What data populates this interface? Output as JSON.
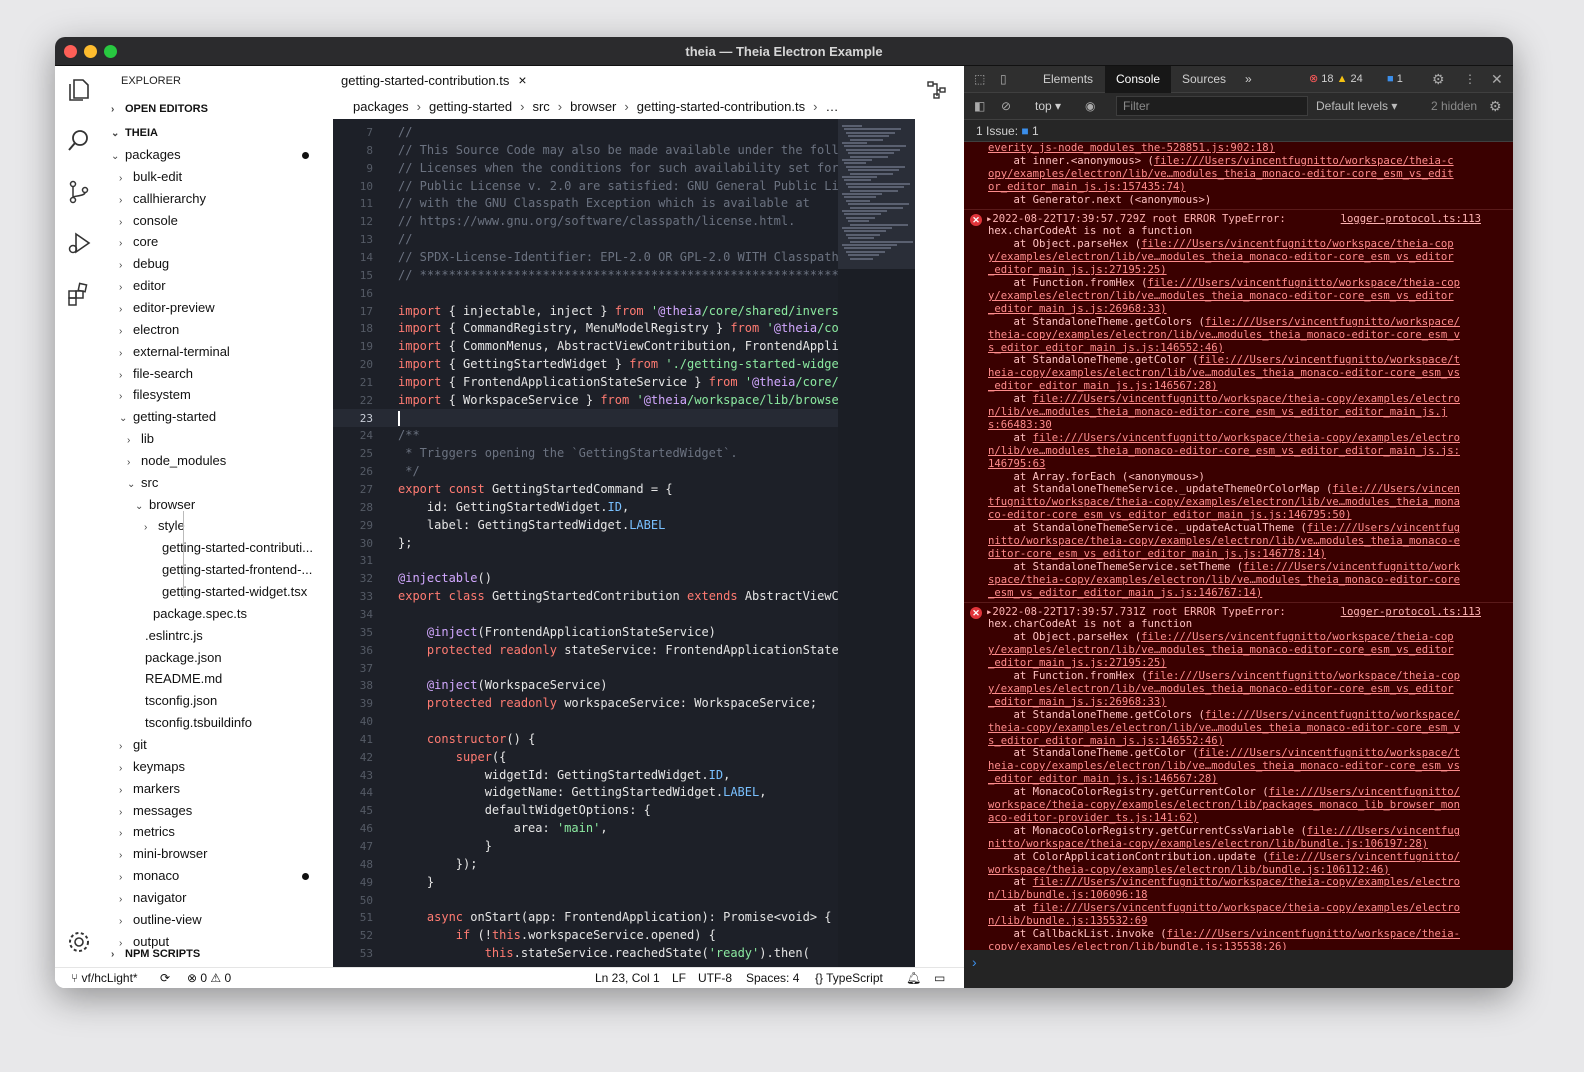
{
  "window": {
    "title": "theia — Theia Electron Example"
  },
  "explorer": {
    "title": "EXPLORER",
    "open_editors": "OPEN EDITORS",
    "root": "THEIA",
    "npm_scripts": "NPM SCRIPTS",
    "items": [
      {
        "label": "packages",
        "indent": 0,
        "open": true,
        "dot": true
      },
      {
        "label": "bulk-edit",
        "indent": 1,
        "open": false
      },
      {
        "label": "callhierarchy",
        "indent": 1,
        "open": false
      },
      {
        "label": "console",
        "indent": 1,
        "open": false
      },
      {
        "label": "core",
        "indent": 1,
        "open": false
      },
      {
        "label": "debug",
        "indent": 1,
        "open": false
      },
      {
        "label": "editor",
        "indent": 1,
        "open": false
      },
      {
        "label": "editor-preview",
        "indent": 1,
        "open": false
      },
      {
        "label": "electron",
        "indent": 1,
        "open": false
      },
      {
        "label": "external-terminal",
        "indent": 1,
        "open": false
      },
      {
        "label": "file-search",
        "indent": 1,
        "open": false
      },
      {
        "label": "filesystem",
        "indent": 1,
        "open": false
      },
      {
        "label": "getting-started",
        "indent": 1,
        "open": true
      },
      {
        "label": "lib",
        "indent": 2,
        "open": false
      },
      {
        "label": "node_modules",
        "indent": 2,
        "open": false
      },
      {
        "label": "src",
        "indent": 2,
        "open": true
      },
      {
        "label": "browser",
        "indent": 3,
        "open": true
      },
      {
        "label": "style",
        "indent": 4,
        "open": false
      },
      {
        "label": "getting-started-contributi...",
        "indent": 4,
        "file": true
      },
      {
        "label": "getting-started-frontend-...",
        "indent": 4,
        "file": true
      },
      {
        "label": "getting-started-widget.tsx",
        "indent": 4,
        "file": true
      },
      {
        "label": "package.spec.ts",
        "indent": 3,
        "file": true
      },
      {
        "label": ".eslintrc.js",
        "indent": 2,
        "file": true
      },
      {
        "label": "package.json",
        "indent": 2,
        "file": true
      },
      {
        "label": "README.md",
        "indent": 2,
        "file": true
      },
      {
        "label": "tsconfig.json",
        "indent": 2,
        "file": true
      },
      {
        "label": "tsconfig.tsbuildinfo",
        "indent": 2,
        "file": true
      },
      {
        "label": "git",
        "indent": 1,
        "open": false
      },
      {
        "label": "keymaps",
        "indent": 1,
        "open": false
      },
      {
        "label": "markers",
        "indent": 1,
        "open": false
      },
      {
        "label": "messages",
        "indent": 1,
        "open": false
      },
      {
        "label": "metrics",
        "indent": 1,
        "open": false
      },
      {
        "label": "mini-browser",
        "indent": 1,
        "open": false
      },
      {
        "label": "monaco",
        "indent": 1,
        "open": false,
        "dot": true
      },
      {
        "label": "navigator",
        "indent": 1,
        "open": false
      },
      {
        "label": "outline-view",
        "indent": 1,
        "open": false
      },
      {
        "label": "output",
        "indent": 1,
        "open": false
      }
    ]
  },
  "editor": {
    "tab": "getting-started-contribution.ts",
    "tab_close": "×",
    "breadcrumbs": [
      "packages",
      "getting-started",
      "src",
      "browser",
      "getting-started-contribution.ts",
      "…"
    ],
    "lines": [
      {
        "n": "7",
        "t": "//"
      },
      {
        "n": "8",
        "t": "// This Source Code may also be made available under the foll"
      },
      {
        "n": "9",
        "t": "// Licenses when the conditions for such availability set for"
      },
      {
        "n": "10",
        "t": "// Public License v. 2.0 are satisfied: GNU General Public Li"
      },
      {
        "n": "11",
        "t": "// with the GNU Classpath Exception which is available at"
      },
      {
        "n": "12",
        "t": "// https://www.gnu.org/software/classpath/license.html."
      },
      {
        "n": "13",
        "t": "//"
      },
      {
        "n": "14",
        "t": "// SPDX-License-Identifier: EPL-2.0 OR GPL-2.0 WITH Classpath"
      },
      {
        "n": "15",
        "t": "// *************************************************************"
      },
      {
        "n": "16",
        "t": ""
      },
      {
        "n": "17",
        "t": "import { injectable, inject } from '@theia/core/shared/invers"
      },
      {
        "n": "18",
        "t": "import { CommandRegistry, MenuModelRegistry } from '@theia/co"
      },
      {
        "n": "19",
        "t": "import { CommonMenus, AbstractViewContribution, FrontendAppli"
      },
      {
        "n": "20",
        "t": "import { GettingStartedWidget } from './getting-started-widge"
      },
      {
        "n": "21",
        "t": "import { FrontendApplicationStateService } from '@theia/core/"
      },
      {
        "n": "22",
        "t": "import { WorkspaceService } from '@theia/workspace/lib/browse"
      },
      {
        "n": "23",
        "t": ""
      },
      {
        "n": "24",
        "t": "/**"
      },
      {
        "n": "25",
        "t": " * Triggers opening the `GettingStartedWidget`."
      },
      {
        "n": "26",
        "t": " */"
      },
      {
        "n": "27",
        "t": "export const GettingStartedCommand = {"
      },
      {
        "n": "28",
        "t": "    id: GettingStartedWidget.ID,"
      },
      {
        "n": "29",
        "t": "    label: GettingStartedWidget.LABEL"
      },
      {
        "n": "30",
        "t": "};"
      },
      {
        "n": "31",
        "t": ""
      },
      {
        "n": "32",
        "t": "@injectable()"
      },
      {
        "n": "33",
        "t": "export class GettingStartedContribution extends AbstractViewCo"
      },
      {
        "n": "34",
        "t": ""
      },
      {
        "n": "35",
        "t": "    @inject(FrontendApplicationStateService)"
      },
      {
        "n": "36",
        "t": "    protected readonly stateService: FrontendApplicationState"
      },
      {
        "n": "37",
        "t": ""
      },
      {
        "n": "38",
        "t": "    @inject(WorkspaceService)"
      },
      {
        "n": "39",
        "t": "    protected readonly workspaceService: WorkspaceService;"
      },
      {
        "n": "40",
        "t": ""
      },
      {
        "n": "41",
        "t": "    constructor() {"
      },
      {
        "n": "42",
        "t": "        super({"
      },
      {
        "n": "43",
        "t": "            widgetId: GettingStartedWidget.ID,"
      },
      {
        "n": "44",
        "t": "            widgetName: GettingStartedWidget.LABEL,"
      },
      {
        "n": "45",
        "t": "            defaultWidgetOptions: {"
      },
      {
        "n": "46",
        "t": "                area: 'main',"
      },
      {
        "n": "47",
        "t": "            }"
      },
      {
        "n": "48",
        "t": "        });"
      },
      {
        "n": "49",
        "t": "    }"
      },
      {
        "n": "50",
        "t": ""
      },
      {
        "n": "51",
        "t": "    async onStart(app: FrontendApplication): Promise<void> {"
      },
      {
        "n": "52",
        "t": "        if (!this.workspaceService.opened) {"
      },
      {
        "n": "53",
        "t": "            this.stateService.reachedState('ready').then("
      }
    ],
    "current_line": "23"
  },
  "statusbar": {
    "branch": "vf/hcLight*",
    "problems_errors": "0",
    "problems_warnings": "0",
    "position": "Ln 23, Col 1",
    "eol": "LF",
    "encoding": "UTF-8",
    "spaces": "Spaces: 4",
    "language": "TypeScript"
  },
  "devtools": {
    "tabs": [
      "Elements",
      "Console",
      "Sources"
    ],
    "more": "»",
    "errors": "18",
    "warnings": "24",
    "messages": "1",
    "context": "top ▾",
    "filter_placeholder": "Filter",
    "levels": "Default levels ▾",
    "hidden": "2 hidden",
    "issues_label": "1 Issue:",
    "issues_count": "1",
    "prompt": "›",
    "entries": [
      {
        "type": "cont",
        "lines": [
          {
            "k": "l",
            "t": "everity_js-node_modules_the-528851.js:902:18)"
          },
          {
            "k": "m",
            "pre": "    at inner.<anonymous> (",
            "t": "file:///Users/vincentfugnitto/workspace/theia-c"
          },
          {
            "k": "l",
            "t": "opy/examples/electron/lib/ve…modules_theia_monaco-editor-core_esm_vs_edit"
          },
          {
            "k": "lm",
            "t": "or_editor_main_js.js:157435:74)"
          },
          {
            "k": "x",
            "t": "    at Generator.next (<anonymous>)"
          }
        ]
      },
      {
        "type": "err",
        "head": "▸2022-08-22T17:39:57.729Z root ERROR TypeError:",
        "src": "logger-protocol.ts:113",
        "lines": [
          {
            "k": "x",
            "t": "hex.charCodeAt is not a function"
          },
          {
            "k": "m",
            "pre": "    at Object.parseHex (",
            "t": "file:///Users/vincentfugnitto/workspace/theia-cop"
          },
          {
            "k": "l",
            "t": "y/examples/electron/lib/ve…modules_theia_monaco-editor-core_esm_vs_editor"
          },
          {
            "k": "lm",
            "t": "_editor_main_js.js:27195:25)"
          },
          {
            "k": "m",
            "pre": "    at Function.fromHex (",
            "t": "file:///Users/vincentfugnitto/workspace/theia-cop"
          },
          {
            "k": "l",
            "t": "y/examples/electron/lib/ve…modules_theia_monaco-editor-core_esm_vs_editor"
          },
          {
            "k": "lm",
            "t": "_editor_main_js.js:26968:33)"
          },
          {
            "k": "m",
            "pre": "    at StandaloneTheme.getColors (",
            "t": "file:///Users/vincentfugnitto/workspace/"
          },
          {
            "k": "l",
            "t": "theia-copy/examples/electron/lib/ve…modules_theia_monaco-editor-core_esm_v"
          },
          {
            "k": "lm",
            "t": "s_editor_editor_main_js.js:146552:46)"
          },
          {
            "k": "m",
            "pre": "    at StandaloneTheme.getColor (",
            "t": "file:///Users/vincentfugnitto/workspace/t"
          },
          {
            "k": "l",
            "t": "heia-copy/examples/electron/lib/ve…modules_theia_monaco-editor-core_esm_vs"
          },
          {
            "k": "lm",
            "t": "_editor_editor_main_js.js:146567:28)"
          },
          {
            "k": "m",
            "pre": "    at ",
            "t": "file:///Users/vincentfugnitto/workspace/theia-copy/examples/electro"
          },
          {
            "k": "l",
            "t": "n/lib/ve…modules_theia_monaco-editor-core_esm_vs_editor_editor_main_js.j"
          },
          {
            "k": "lm",
            "t": "s:66483:30"
          },
          {
            "k": "m",
            "pre": "    at ",
            "t": "file:///Users/vincentfugnitto/workspace/theia-copy/examples/electro"
          },
          {
            "k": "l",
            "t": "n/lib/ve…modules_theia_monaco-editor-core_esm_vs_editor_editor_main_js.js:"
          },
          {
            "k": "lm",
            "t": "146795:63"
          },
          {
            "k": "x",
            "t": "    at Array.forEach (<anonymous>)"
          },
          {
            "k": "m",
            "pre": "    at StandaloneThemeService._updateThemeOrColorMap (",
            "t": "file:///Users/vincen"
          },
          {
            "k": "l",
            "t": "tfugnitto/workspace/theia-copy/examples/electron/lib/ve…modules_theia_mona"
          },
          {
            "k": "lm",
            "t": "co-editor-core_esm_vs_editor_editor_main_js.js:146795:50)"
          },
          {
            "k": "m",
            "pre": "    at StandaloneThemeService._updateActualTheme (",
            "t": "file:///Users/vincentfug"
          },
          {
            "k": "l",
            "t": "nitto/workspace/theia-copy/examples/electron/lib/ve…modules_theia_monaco-e"
          },
          {
            "k": "lm",
            "t": "ditor-core_esm_vs_editor_editor_main_js.js:146778:14)"
          },
          {
            "k": "m",
            "pre": "    at StandaloneThemeService.setTheme (",
            "t": "file:///Users/vincentfugnitto/work"
          },
          {
            "k": "l",
            "t": "space/theia-copy/examples/electron/lib/ve…modules_theia_monaco-editor-core"
          },
          {
            "k": "lm",
            "t": "_esm_vs_editor_editor_main_js.js:146767:14)"
          }
        ]
      },
      {
        "type": "err",
        "head": "▸2022-08-22T17:39:57.731Z root ERROR TypeError:",
        "src": "logger-protocol.ts:113",
        "lines": [
          {
            "k": "x",
            "t": "hex.charCodeAt is not a function"
          },
          {
            "k": "m",
            "pre": "    at Object.parseHex (",
            "t": "file:///Users/vincentfugnitto/workspace/theia-cop"
          },
          {
            "k": "l",
            "t": "y/examples/electron/lib/ve…modules_theia_monaco-editor-core_esm_vs_editor"
          },
          {
            "k": "lm",
            "t": "_editor_main_js.js:27195:25)"
          },
          {
            "k": "m",
            "pre": "    at Function.fromHex (",
            "t": "file:///Users/vincentfugnitto/workspace/theia-cop"
          },
          {
            "k": "l",
            "t": "y/examples/electron/lib/ve…modules_theia_monaco-editor-core_esm_vs_editor"
          },
          {
            "k": "lm",
            "t": "_editor_main_js.js:26968:33)"
          },
          {
            "k": "m",
            "pre": "    at StandaloneTheme.getColors (",
            "t": "file:///Users/vincentfugnitto/workspace/"
          },
          {
            "k": "l",
            "t": "theia-copy/examples/electron/lib/ve…modules_theia_monaco-editor-core_esm_v"
          },
          {
            "k": "lm",
            "t": "s_editor_editor_main_js.js:146552:46)"
          },
          {
            "k": "m",
            "pre": "    at StandaloneTheme.getColor (",
            "t": "file:///Users/vincentfugnitto/workspace/t"
          },
          {
            "k": "l",
            "t": "heia-copy/examples/electron/lib/ve…modules_theia_monaco-editor-core_esm_vs"
          },
          {
            "k": "lm",
            "t": "_editor_editor_main_js.js:146567:28)"
          },
          {
            "k": "m",
            "pre": "    at MonacoColorRegistry.getCurrentColor (",
            "t": "file:///Users/vincentfugnitto/"
          },
          {
            "k": "l",
            "t": "workspace/theia-copy/examples/electron/lib/packages_monaco_lib_browser_mon"
          },
          {
            "k": "lm",
            "t": "aco-editor-provider_ts.js:141:62)"
          },
          {
            "k": "m",
            "pre": "    at MonacoColorRegistry.getCurrentCssVariable (",
            "t": "file:///Users/vincentfug"
          },
          {
            "k": "lm",
            "t": "nitto/workspace/theia-copy/examples/electron/lib/bundle.js:106197:28)"
          },
          {
            "k": "m",
            "pre": "    at ColorApplicationContribution.update (",
            "t": "file:///Users/vincentfugnitto/"
          },
          {
            "k": "lm",
            "t": "workspace/theia-copy/examples/electron/lib/bundle.js:106112:46)"
          },
          {
            "k": "m",
            "pre": "    at ",
            "t": "file:///Users/vincentfugnitto/workspace/theia-copy/examples/electro"
          },
          {
            "k": "lm",
            "t": "n/lib/bundle.js:106096:18"
          },
          {
            "k": "m",
            "pre": "    at ",
            "t": "file:///Users/vincentfugnitto/workspace/theia-copy/examples/electro"
          },
          {
            "k": "lm",
            "t": "n/lib/bundle.js:135532:69"
          },
          {
            "k": "m",
            "pre": "    at CallbackList.invoke (",
            "t": "file:///Users/vincentfugnitto/workspace/theia-"
          },
          {
            "k": "lm",
            "t": "copy/examples/electron/lib/bundle.js:135538:26)"
          }
        ]
      }
    ]
  },
  "colors": {
    "error_bg": "#3a0000",
    "accent": "#3b8eea",
    "editor_bg": "#1d2028"
  }
}
